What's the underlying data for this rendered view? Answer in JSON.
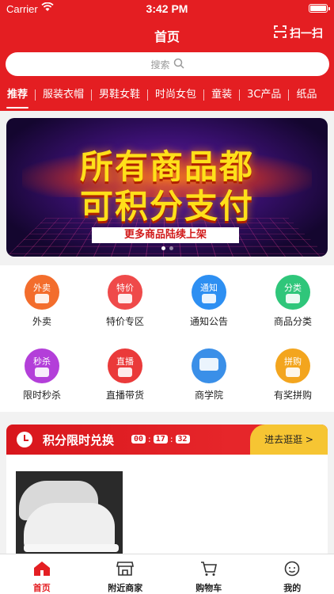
{
  "status_bar": {
    "carrier": "Carrier",
    "time": "3:42 PM"
  },
  "nav": {
    "title": "首页",
    "scan_label": "扫一扫"
  },
  "search": {
    "placeholder": "搜索"
  },
  "categories": [
    "推荐",
    "服装衣帽",
    "男鞋女鞋",
    "时尚女包",
    "童装",
    "3C产品",
    "纸品"
  ],
  "banner": {
    "line1": "所有商品都",
    "line2": "可积分支付",
    "subtitle": "更多商品陆续上架"
  },
  "menu": [
    {
      "label": "外卖",
      "icon_text": "外卖",
      "icon": "takeout-icon",
      "color": "#f36d2c"
    },
    {
      "label": "特价专区",
      "icon_text": "特价",
      "icon": "discount-icon",
      "color": "#ef4a4a"
    },
    {
      "label": "通知公告",
      "icon_text": "通知",
      "icon": "notice-icon",
      "color": "#2d8ff2"
    },
    {
      "label": "商品分类",
      "icon_text": "分类",
      "icon": "category-icon",
      "color": "#2fc67a"
    },
    {
      "label": "限时秒杀",
      "icon_text": "秒杀",
      "icon": "flash-sale-icon",
      "color": "#b33fd9"
    },
    {
      "label": "直播带货",
      "icon_text": "直播",
      "icon": "live-icon",
      "color": "#ea3a3a"
    },
    {
      "label": "商学院",
      "icon_text": "",
      "icon": "academy-icon",
      "color": "#3a8fe8"
    },
    {
      "label": "有奖拼购",
      "icon_text": "拼购",
      "icon": "group-buy-icon",
      "color": "#f3a51e"
    }
  ],
  "flash_sale": {
    "title": "积分限时兑换",
    "timer": [
      "00",
      "17",
      "32"
    ],
    "more_label": "进去逛逛 >"
  },
  "tabbar": [
    {
      "label": "首页",
      "icon": "home-icon",
      "active": true
    },
    {
      "label": "附近商家",
      "icon": "store-icon",
      "active": false
    },
    {
      "label": "购物车",
      "icon": "cart-icon",
      "active": false
    },
    {
      "label": "我的",
      "icon": "profile-icon",
      "active": false
    }
  ],
  "colors": {
    "brand_red": "#e41e22",
    "gold": "#f6c533"
  }
}
